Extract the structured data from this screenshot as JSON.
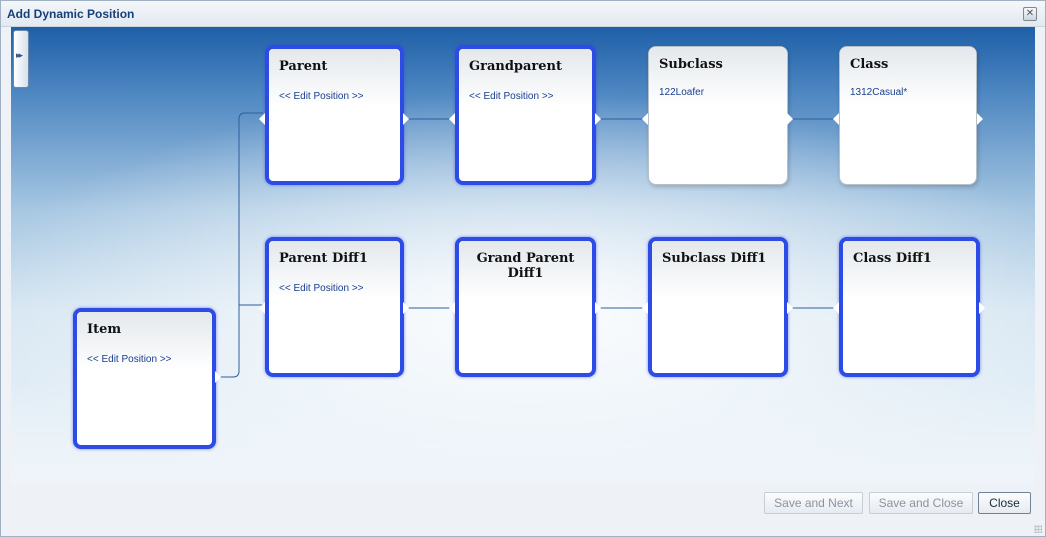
{
  "dialog": {
    "title": "Add Dynamic Position"
  },
  "nodes": {
    "parent": {
      "label": "Parent",
      "link": "<< Edit Position >>"
    },
    "grandparent": {
      "label": "Grandparent",
      "link": "<< Edit Position >>"
    },
    "subclass": {
      "label": "Subclass",
      "value": "122Loafer"
    },
    "class": {
      "label": "Class",
      "value": "1312Casual*"
    },
    "item": {
      "label": "Item",
      "link": "<< Edit Position >>"
    },
    "parent_diff1": {
      "label": "Parent Diff1",
      "link": "<< Edit Position >>"
    },
    "grand_parent_diff1": {
      "label": "Grand Parent Diff1"
    },
    "subclass_diff1": {
      "label": "Subclass Diff1"
    },
    "class_diff1": {
      "label": "Class Diff1"
    }
  },
  "footer": {
    "save_next": "Save and Next",
    "save_close": "Save and Close",
    "close": "Close"
  },
  "colors": {
    "selected_border": "#2d4ce6",
    "connector": "#2e5e9e",
    "title_text": "#15407b",
    "link_text": "#1a3f8f"
  }
}
